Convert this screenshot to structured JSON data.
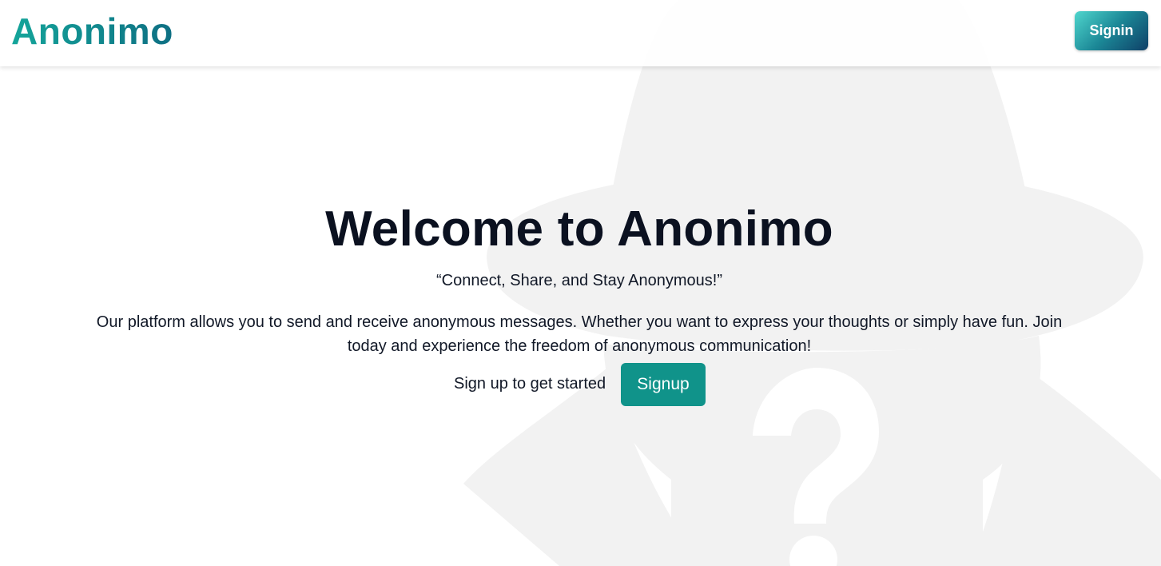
{
  "brand": {
    "name": "Anonimo"
  },
  "header": {
    "signin_label": "Signin"
  },
  "hero": {
    "title": "Welcome to Anonimo",
    "tagline": "“Connect, Share, and Stay Anonymous!”",
    "description": "Our platform allows you to send and receive anonymous messages. Whether you want to express your thoughts or simply have fun. Join today and experience the freedom of anonymous communication!",
    "cta_text": "Sign up to get started",
    "signup_label": "Signup"
  },
  "colors": {
    "brand_gradient_start": "#14a59a",
    "brand_gradient_end": "#0e6f83",
    "signup_button": "#10938a",
    "background_figure": "#f2f2f2"
  },
  "icons": {
    "background": "anonymous-figure-icon"
  }
}
